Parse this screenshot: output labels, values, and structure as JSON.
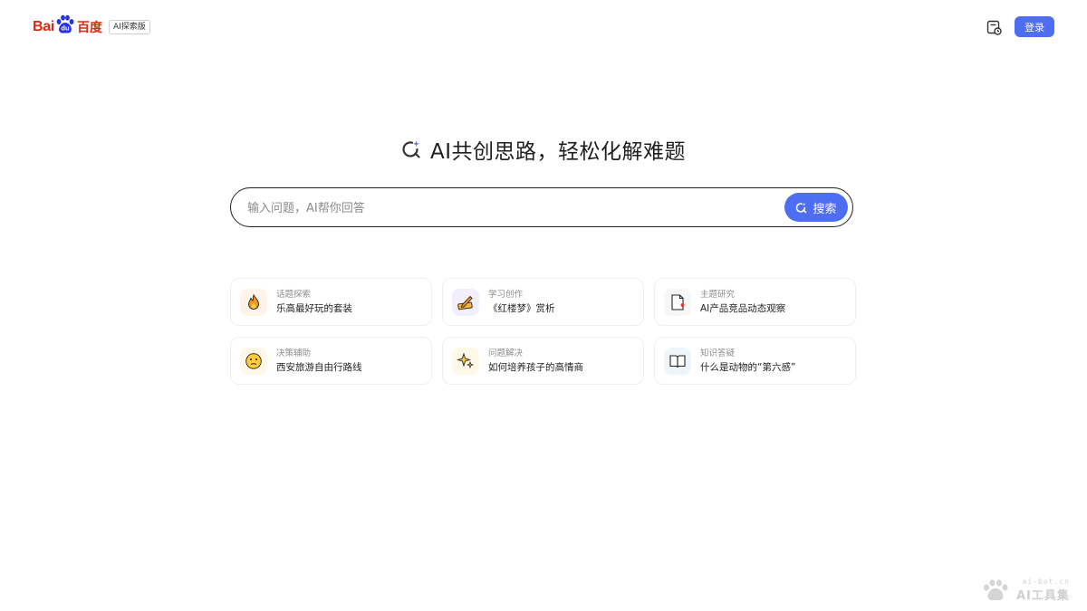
{
  "header": {
    "logo_prefix": "Bai",
    "logo_paw_text": "du",
    "logo_cn": "百度",
    "badge": "AI探索版",
    "history_icon": "history-icon",
    "login_label": "登录"
  },
  "hero": {
    "headline": "AI共创思路，轻松化解难题",
    "search_placeholder": "输入问题，AI帮你回答",
    "search_value": "",
    "search_button": "搜索"
  },
  "cards": [
    {
      "category": "话题探索",
      "title": "乐高最好玩的套装",
      "icon": "fire-icon"
    },
    {
      "category": "学习创作",
      "title": "《红楼梦》赏析",
      "icon": "pen-writing-icon"
    },
    {
      "category": "主题研究",
      "title": "AI产品竞品动态观察",
      "icon": "document-icon"
    },
    {
      "category": "决策辅助",
      "title": "西安旅游自由行路线",
      "icon": "thinking-face-icon"
    },
    {
      "category": "问题解决",
      "title": "如何培养孩子的高情商",
      "icon": "sparkle-icon"
    },
    {
      "category": "知识答疑",
      "title": "什么是动物的“第六感”",
      "icon": "open-book-icon"
    }
  ],
  "watermark": {
    "url": "ai-bot.cn",
    "name": "AI工具集"
  },
  "colors": {
    "accent": "#4e6ef2",
    "brand_red": "#de2910",
    "paw_blue": "#2932e1"
  }
}
